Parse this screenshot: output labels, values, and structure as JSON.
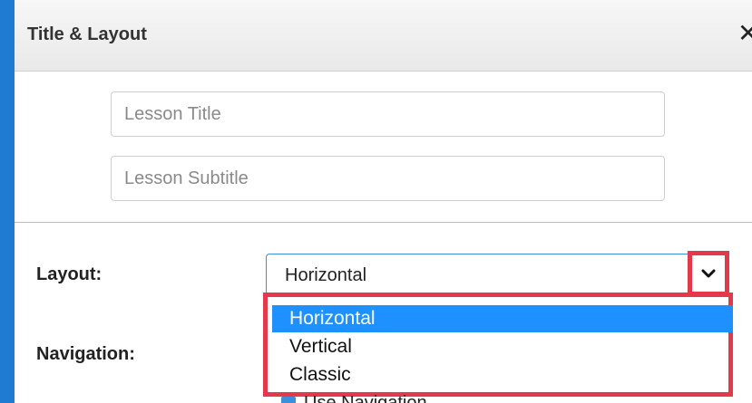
{
  "dialog": {
    "title": "Title & Layout",
    "close_symbol": "✕",
    "lesson_title_placeholder": "Lesson Title",
    "lesson_subtitle_placeholder": "Lesson Subtitle",
    "layout_label": "Layout:",
    "navigation_label": "Navigation:",
    "layout_selected": "Horizontal",
    "layout_options": [
      {
        "label": "Horizontal",
        "selected": true
      },
      {
        "label": "Vertical",
        "selected": false
      },
      {
        "label": "Classic",
        "selected": false
      }
    ],
    "navigation_option_partial": "Use Navigation"
  },
  "colors": {
    "accent_blue": "#1e90ff",
    "highlight_red": "#e23a4a",
    "frame_blue": "#1f7ad1"
  },
  "icons": {
    "close": "close-icon",
    "dropdown": "chevron-down-icon"
  }
}
